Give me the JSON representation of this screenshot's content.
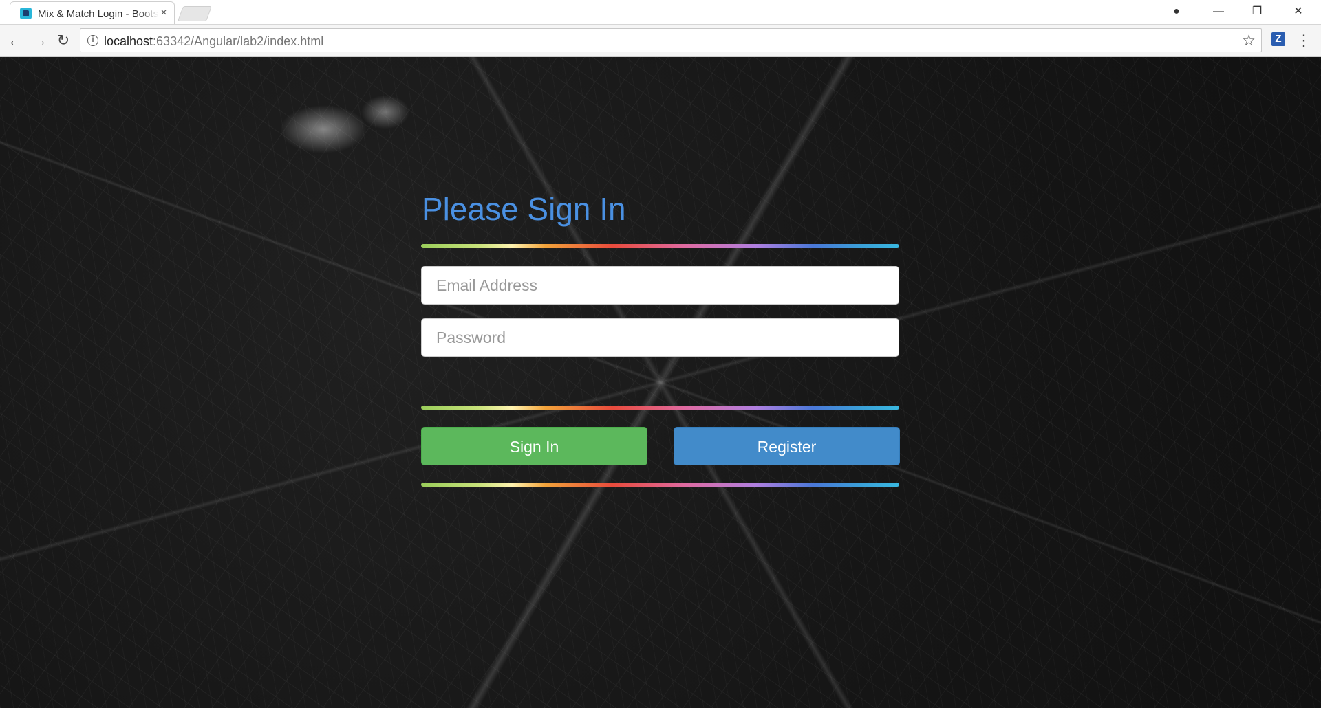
{
  "browser": {
    "tab_title": "Mix & Match Login - Bootstrap",
    "tab_close": "×",
    "url_host": "localhost",
    "url_path": ":63342/Angular/lab2/index.html",
    "ext_label": "Z",
    "controls": {
      "back": "←",
      "forward": "→",
      "reload": "↻",
      "menu": "⋮",
      "profile": "●",
      "minimize": "—",
      "restore": "❐",
      "close": "✕",
      "star": "☆",
      "info": "i"
    },
    "icons": [
      "back-icon",
      "forward-icon",
      "reload-icon",
      "info-icon",
      "star-icon",
      "menu-icon",
      "profile-icon"
    ]
  },
  "login": {
    "title": "Please Sign In",
    "email_placeholder": "Email Address",
    "password_placeholder": "Password",
    "signin_label": "Sign In",
    "register_label": "Register"
  },
  "colors": {
    "title": "#4a90e2",
    "signin_button": "#5cb85c",
    "register_button": "#428bca"
  }
}
